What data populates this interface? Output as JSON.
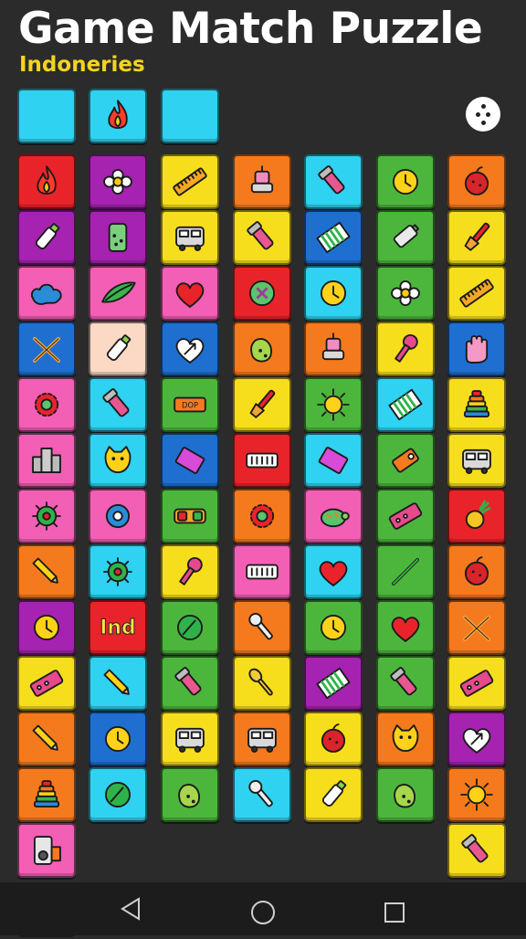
{
  "header": {
    "title": "Game Match Puzzle",
    "subtitle": "Indoneries"
  },
  "tray": [
    {
      "color": "#2fd2f0",
      "icon": "candy-icon"
    },
    {
      "color": "#2fd2f0",
      "icon": "flame-icon"
    },
    {
      "color": "#2fd2f0",
      "icon": "flag-card-icon"
    }
  ],
  "menu": {
    "icon": "more-options-icon"
  },
  "board": [
    [
      {
        "color": "#e8242a",
        "icon": "flame-icon"
      },
      {
        "color": "#a523b0",
        "icon": "flower-icon"
      },
      {
        "color": "#f7de1c",
        "icon": "ruler-icon"
      },
      {
        "color": "#f57a1e",
        "icon": "robot-icon"
      },
      {
        "color": "#2fd2f0",
        "icon": "flashlight-icon"
      },
      {
        "color": "#4cb63c",
        "icon": "clock-icon"
      },
      {
        "color": "#f57a1e",
        "icon": "apple-icon"
      }
    ],
    [
      {
        "color": "#a523b0",
        "icon": "bottle-icon"
      },
      {
        "color": "#a523b0",
        "icon": "phone-icon"
      },
      {
        "color": "#f7de1c",
        "icon": "bus-icon"
      },
      {
        "color": "#f7de1c",
        "icon": "flashlight-icon"
      },
      {
        "color": "#1f6fd1",
        "icon": "stripes-icon"
      },
      {
        "color": "#4cb63c",
        "icon": "battery-icon"
      },
      {
        "color": "#f7de1c",
        "icon": "brush-icon"
      }
    ],
    [
      {
        "color": "#f25fb4",
        "icon": "cloud-icon"
      },
      {
        "color": "#f25fb4",
        "icon": "leaf-icon"
      },
      {
        "color": "#f25fb4",
        "icon": "heart-icon"
      },
      {
        "color": "#e8242a",
        "icon": "bug-icon"
      },
      {
        "color": "#2fd2f0",
        "icon": "clock-icon"
      },
      {
        "color": "#4cb63c",
        "icon": "flower-icon"
      },
      {
        "color": "#f7de1c",
        "icon": "ruler-icon"
      }
    ],
    [
      {
        "color": "#1f6fd1",
        "icon": "cross-sticks-icon"
      },
      {
        "color": "#fbd9c4",
        "icon": "bottle-icon"
      },
      {
        "color": "#1f6fd1",
        "icon": "heart-arrow-icon"
      },
      {
        "color": "#f57a1e",
        "icon": "fruit-icon"
      },
      {
        "color": "#f57a1e",
        "icon": "robot-icon"
      },
      {
        "color": "#f7de1c",
        "icon": "key-icon"
      },
      {
        "color": "#1f6fd1",
        "icon": "hand-icon"
      }
    ],
    [
      {
        "color": "#f25fb4",
        "icon": "gear-icon"
      },
      {
        "color": "#2fd2f0",
        "icon": "flashlight-icon"
      },
      {
        "color": "#4cb63c",
        "icon": "label-icon"
      },
      {
        "color": "#f7de1c",
        "icon": "brush-icon"
      },
      {
        "color": "#4cb63c",
        "icon": "sun-icon"
      },
      {
        "color": "#2fd2f0",
        "icon": "stripes-icon"
      },
      {
        "color": "#f7de1c",
        "icon": "stack-icon"
      }
    ],
    [
      {
        "color": "#f25fb4",
        "icon": "building-icon"
      },
      {
        "color": "#2fd2f0",
        "icon": "cat-face-icon"
      },
      {
        "color": "#1f6fd1",
        "icon": "card-icon"
      },
      {
        "color": "#e8242a",
        "icon": "keyboard-icon"
      },
      {
        "color": "#2fd2f0",
        "icon": "card-icon"
      },
      {
        "color": "#4cb63c",
        "icon": "tag-icon"
      },
      {
        "color": "#f7de1c",
        "icon": "bus-icon"
      }
    ],
    [
      {
        "color": "#f25fb4",
        "icon": "virus-icon"
      },
      {
        "color": "#f25fb4",
        "icon": "fan-icon"
      },
      {
        "color": "#4cb63c",
        "icon": "switch-icon"
      },
      {
        "color": "#f57a1e",
        "icon": "gear-icon"
      },
      {
        "color": "#f25fb4",
        "icon": "turtle-icon"
      },
      {
        "color": "#4cb63c",
        "icon": "ticket-icon"
      },
      {
        "color": "#e8242a",
        "icon": "pineapple-icon"
      }
    ],
    [
      {
        "color": "#f57a1e",
        "icon": "pencil-icon"
      },
      {
        "color": "#2fd2f0",
        "icon": "virus-icon"
      },
      {
        "color": "#f7de1c",
        "icon": "key-icon"
      },
      {
        "color": "#f25fb4",
        "icon": "keyboard-icon"
      },
      {
        "color": "#2fd2f0",
        "icon": "heart-icon"
      },
      {
        "color": "#4cb63c",
        "icon": "wand-icon"
      },
      {
        "color": "#f57a1e",
        "icon": "apple-icon"
      }
    ],
    [
      {
        "color": "#a523b0",
        "icon": "clock-icon"
      },
      {
        "color": "#e8242a",
        "icon": "text-tile",
        "text": "Ind"
      },
      {
        "color": "#4cb63c",
        "icon": "compass-icon"
      },
      {
        "color": "#f57a1e",
        "icon": "wrench-icon"
      },
      {
        "color": "#4cb63c",
        "icon": "clock-icon"
      },
      {
        "color": "#4cb63c",
        "icon": "heart-icon"
      },
      {
        "color": "#f57a1e",
        "icon": "cross-sticks-icon"
      }
    ],
    [
      {
        "color": "#f7de1c",
        "icon": "ticket-icon"
      },
      {
        "color": "#2fd2f0",
        "icon": "pencil-icon"
      },
      {
        "color": "#4cb63c",
        "icon": "flashlight-icon"
      },
      {
        "color": "#f7de1c",
        "icon": "spoon-icon"
      },
      {
        "color": "#a523b0",
        "icon": "stripes-icon"
      },
      {
        "color": "#4cb63c",
        "icon": "flashlight-icon"
      },
      {
        "color": "#f7de1c",
        "icon": "ticket-icon"
      }
    ],
    [
      {
        "color": "#f57a1e",
        "icon": "pencil-icon"
      },
      {
        "color": "#1f6fd1",
        "icon": "clock-icon"
      },
      {
        "color": "#f7de1c",
        "icon": "bus-icon"
      },
      {
        "color": "#f57a1e",
        "icon": "bus-icon"
      },
      {
        "color": "#f7de1c",
        "icon": "apple-icon"
      },
      {
        "color": "#f57a1e",
        "icon": "cat-face-icon"
      },
      {
        "color": "#a523b0",
        "icon": "heart-arrow-icon"
      }
    ],
    [
      {
        "color": "#f57a1e",
        "icon": "stack-icon"
      },
      {
        "color": "#2fd2f0",
        "icon": "compass-icon"
      },
      {
        "color": "#4cb63c",
        "icon": "fruit-icon"
      },
      {
        "color": "#2fd2f0",
        "icon": "wrench-icon"
      },
      {
        "color": "#f7de1c",
        "icon": "bottle-icon"
      },
      {
        "color": "#4cb63c",
        "icon": "fruit-icon"
      },
      {
        "color": "#f57a1e",
        "icon": "sun-icon"
      }
    ],
    [
      {
        "color": "#f25fb4",
        "icon": "speaker-icon"
      },
      null,
      null,
      null,
      null,
      null,
      {
        "color": "#f7de1c",
        "icon": "flashlight-icon"
      }
    ]
  ],
  "selected_slot": {
    "color": "#6b5510",
    "icon": "ruler-icon"
  },
  "navbar": {
    "back": "back-icon",
    "home": "home-icon",
    "recents": "recents-icon"
  }
}
